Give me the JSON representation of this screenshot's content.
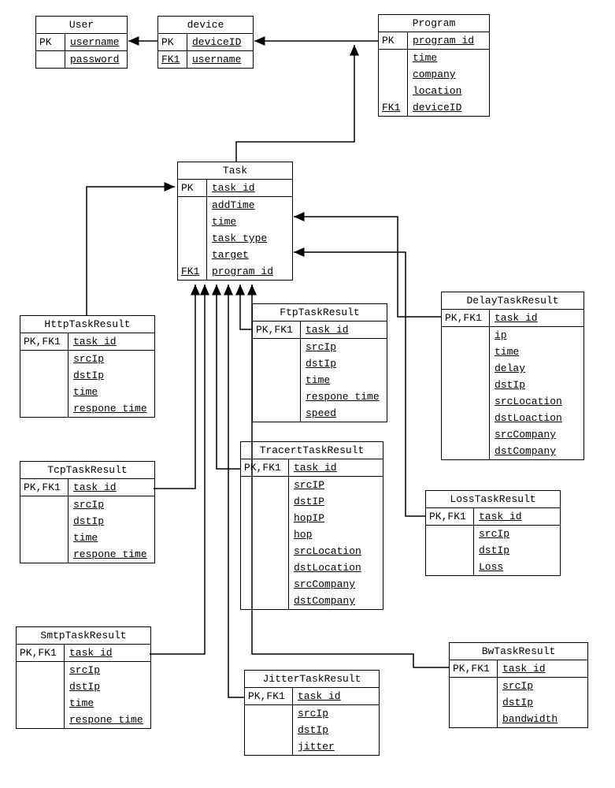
{
  "entities": {
    "user": {
      "title": "User",
      "pk_key": "PK",
      "pk_attr": "username",
      "attrs": [
        "password"
      ]
    },
    "device": {
      "title": "device",
      "pk_key": "PK",
      "pk_attr": "deviceID",
      "fk_key": "FK1",
      "fk_attr": "username"
    },
    "program": {
      "title": "Program",
      "pk_key": "PK",
      "pk_attr": "program_id",
      "attrs": [
        "time",
        "company",
        "location"
      ],
      "fk_key": "FK1",
      "fk_attr": "deviceID"
    },
    "task": {
      "title": "Task",
      "pk_key": "PK",
      "pk_attr": "task_id",
      "attrs": [
        "addTime",
        "time",
        "task_type",
        "target"
      ],
      "fk_key": "FK1",
      "fk_attr": "program_id"
    },
    "httpTaskResult": {
      "title": "HttpTaskResult",
      "pk_key": "PK,FK1",
      "pk_attr": "task_id",
      "attrs": [
        "srcIp",
        "dstIp",
        "time",
        "respone_time"
      ]
    },
    "tcpTaskResult": {
      "title": "TcpTaskResult",
      "pk_key": "PK,FK1",
      "pk_attr": "task_id",
      "attrs": [
        "srcIp",
        "dstIp",
        "time",
        "respone_time"
      ]
    },
    "smtpTaskResult": {
      "title": "SmtpTaskResult",
      "pk_key": "PK,FK1",
      "pk_attr": "task_id",
      "attrs": [
        "srcIp",
        "dstIp",
        "time",
        "respone_time"
      ]
    },
    "ftpTaskResult": {
      "title": "FtpTaskResult",
      "pk_key": "PK,FK1",
      "pk_attr": "task_id",
      "attrs": [
        "srcIp",
        "dstIp",
        "time",
        "respone_time",
        "speed"
      ]
    },
    "tracertTaskResult": {
      "title": "TracertTaskResult",
      "pk_key": "PK,FK1",
      "pk_attr": "task_id",
      "attrs": [
        "srcIP",
        "dstIP",
        "hopIP",
        "hop",
        "srcLocation",
        "dstLocation",
        "srcCompany",
        "dstCompany"
      ]
    },
    "jitterTaskResult": {
      "title": "JitterTaskResult",
      "pk_key": "PK,FK1",
      "pk_attr": "task_id",
      "attrs": [
        "srcIp",
        "dstIp",
        "jitter"
      ]
    },
    "delayTaskResult": {
      "title": "DelayTaskResult",
      "pk_key": "PK,FK1",
      "pk_attr": "task_id",
      "attrs": [
        "ip",
        "time",
        "delay",
        "dstIp",
        "srcLocation",
        "dstLoaction",
        "srcCompany",
        "dstCompany"
      ]
    },
    "lossTaskResult": {
      "title": "LossTaskResult",
      "pk_key": "PK,FK1",
      "pk_attr": "task_id",
      "attrs": [
        "srcIp",
        "dstIp",
        "Loss"
      ]
    },
    "bwTaskResult": {
      "title": "BwTaskResult",
      "pk_key": "PK,FK1",
      "pk_attr": "task_id",
      "attrs": [
        "srcIp",
        "dstIp",
        "bandwidth"
      ]
    }
  },
  "relationships": [
    {
      "from": "device",
      "to": "user",
      "fk": "username"
    },
    {
      "from": "program",
      "to": "device",
      "fk": "deviceID"
    },
    {
      "from": "task",
      "to": "program",
      "fk": "program_id"
    },
    {
      "from": "httpTaskResult",
      "to": "task",
      "fk": "task_id"
    },
    {
      "from": "tcpTaskResult",
      "to": "task",
      "fk": "task_id"
    },
    {
      "from": "smtpTaskResult",
      "to": "task",
      "fk": "task_id"
    },
    {
      "from": "ftpTaskResult",
      "to": "task",
      "fk": "task_id"
    },
    {
      "from": "tracertTaskResult",
      "to": "task",
      "fk": "task_id"
    },
    {
      "from": "jitterTaskResult",
      "to": "task",
      "fk": "task_id"
    },
    {
      "from": "delayTaskResult",
      "to": "task",
      "fk": "task_id"
    },
    {
      "from": "lossTaskResult",
      "to": "task",
      "fk": "task_id"
    },
    {
      "from": "bwTaskResult",
      "to": "task",
      "fk": "task_id"
    }
  ]
}
